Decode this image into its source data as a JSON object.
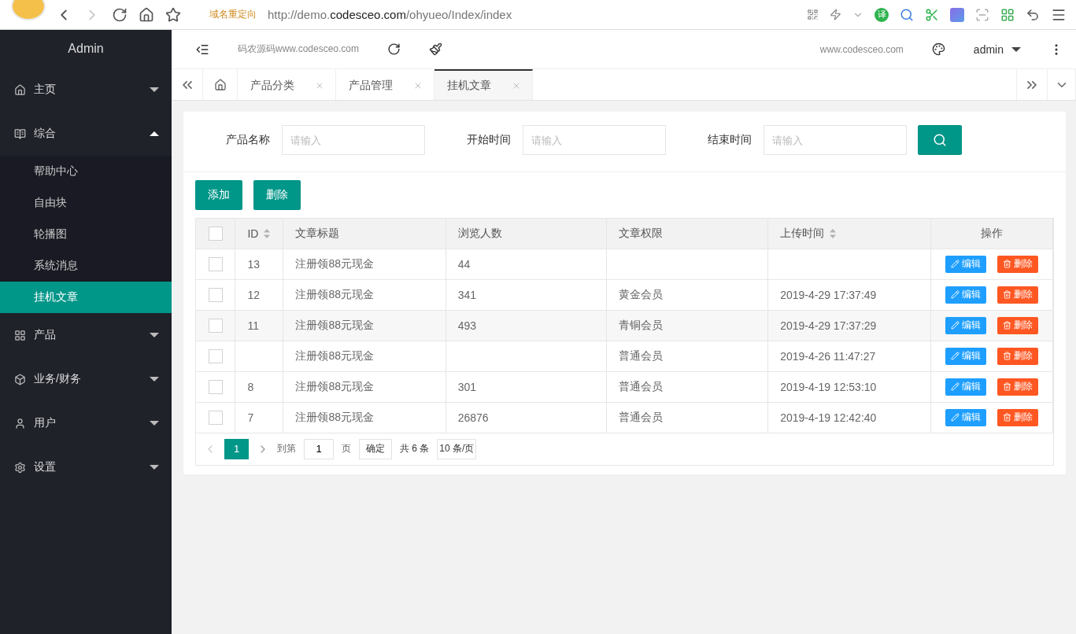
{
  "browser": {
    "redirect_label": "域名重定向",
    "url_host": "http://demo.",
    "url_domain": "codesceo.com",
    "url_path": "/ohyueo/Index/index",
    "translate_label": "译"
  },
  "sidebar": {
    "title": "Admin",
    "items": [
      {
        "label": "主页",
        "expanded": false
      },
      {
        "label": "综合",
        "expanded": true,
        "children": [
          {
            "label": "帮助中心",
            "selected": false
          },
          {
            "label": "自由块",
            "selected": false
          },
          {
            "label": "轮播图",
            "selected": false
          },
          {
            "label": "系统消息",
            "selected": false
          },
          {
            "label": "挂机文章",
            "selected": true
          }
        ]
      },
      {
        "label": "产品",
        "expanded": false
      },
      {
        "label": "业务/财务",
        "expanded": false
      },
      {
        "label": "用户",
        "expanded": false
      },
      {
        "label": "设置",
        "expanded": false
      }
    ]
  },
  "header": {
    "site_text": "码农源码www.codesceo.com",
    "right_text": "www.codesceo.com",
    "user": "admin"
  },
  "tabs": [
    {
      "label": "产品分类",
      "selected": false
    },
    {
      "label": "产品管理",
      "selected": false
    },
    {
      "label": "挂机文章",
      "selected": true
    }
  ],
  "search": {
    "fields": [
      {
        "label": "产品名称",
        "placeholder": "请输入"
      },
      {
        "label": "开始时间",
        "placeholder": "请输入"
      },
      {
        "label": "结束时间",
        "placeholder": "请输入"
      }
    ]
  },
  "actions": [
    "添加",
    "删除"
  ],
  "table": {
    "all_checked": false,
    "columns": [
      {
        "label": "ID",
        "sortable": true
      },
      {
        "label": "文章标题",
        "sortable": false
      },
      {
        "label": "浏览人数",
        "sortable": false
      },
      {
        "label": "文章权限",
        "sortable": false
      },
      {
        "label": "上传时间",
        "sortable": true
      },
      {
        "label": "操作",
        "sortable": false
      }
    ],
    "rows": [
      {
        "checked": false,
        "id": "13",
        "title": "注册领88元现金",
        "views": "44",
        "buttons": [
          "编辑",
          "删除"
        ]
      },
      {
        "checked": false,
        "id": "12",
        "title": "注册领88元现金",
        "views": "341",
        "level": "黄金会员",
        "time": "2019-4-29 17:37:49",
        "buttons": [
          "编辑",
          "删除"
        ]
      },
      {
        "checked": false,
        "id": "11",
        "title": "注册领88元现金",
        "views": "493",
        "level": "青铜会员",
        "time": "2019-4-29 17:37:29",
        "buttons": [
          "编辑",
          "删除"
        ]
      },
      {
        "checked": false,
        "title": "注册领88元现金",
        "level": "普通会员",
        "time": "2019-4-26 11:47:27",
        "buttons": [
          "编辑",
          "删除"
        ]
      },
      {
        "checked": false,
        "id": "8",
        "title": "注册领88元现金",
        "views": "301",
        "level": "普通会员",
        "time": "2019-4-19 12:53:10",
        "buttons": [
          "编辑",
          "删除"
        ]
      },
      {
        "checked": false,
        "id": "7",
        "title": "注册领88元现金",
        "views": "26876",
        "level": "普通会员",
        "time": "2019-4-19 12:42:40",
        "buttons": [
          "编辑",
          "删除"
        ]
      }
    ]
  },
  "pagination": {
    "current": "1",
    "goto_label": "到第",
    "goto_value": "1",
    "page_label": "页",
    "confirm": "确定",
    "total": "共 6 条",
    "page_size": "10 条/页"
  }
}
